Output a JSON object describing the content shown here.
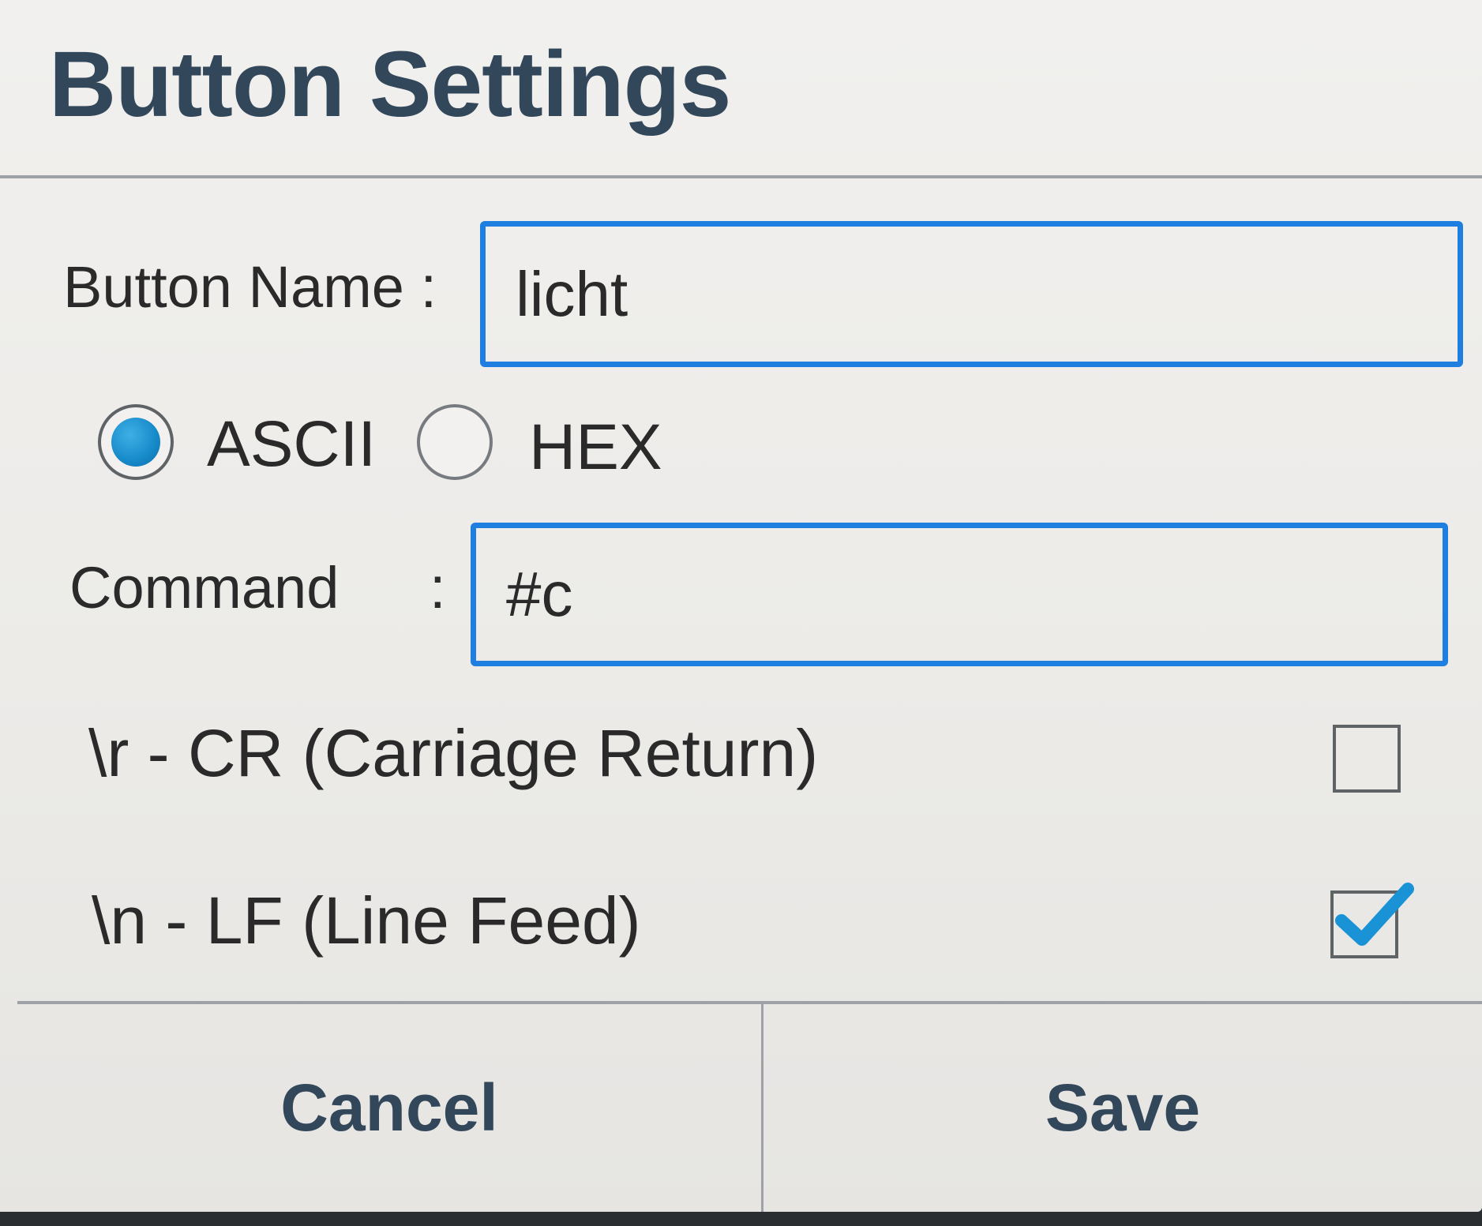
{
  "dialog": {
    "title": "Button Settings"
  },
  "button_name": {
    "label": "Button Name :",
    "value": "licht"
  },
  "encoding": {
    "options": [
      {
        "label": "ASCII",
        "selected": true
      },
      {
        "label": "HEX",
        "selected": false
      }
    ]
  },
  "command": {
    "label": "Command",
    "colon": ":",
    "value": "#c"
  },
  "line_endings": {
    "cr": {
      "label": "\\r - CR (Carriage Return)",
      "checked": false
    },
    "lf": {
      "label": "\\n - LF (Line Feed)",
      "checked": true
    }
  },
  "actions": {
    "cancel_label": "Cancel",
    "save_label": "Save"
  },
  "colors": {
    "accent": "#1f7fe0",
    "title_text": "#33475b",
    "radio_fill": "#1689c9",
    "check": "#1a92d6"
  },
  "icons": {
    "lf_checkbox": "checkmark-icon"
  }
}
